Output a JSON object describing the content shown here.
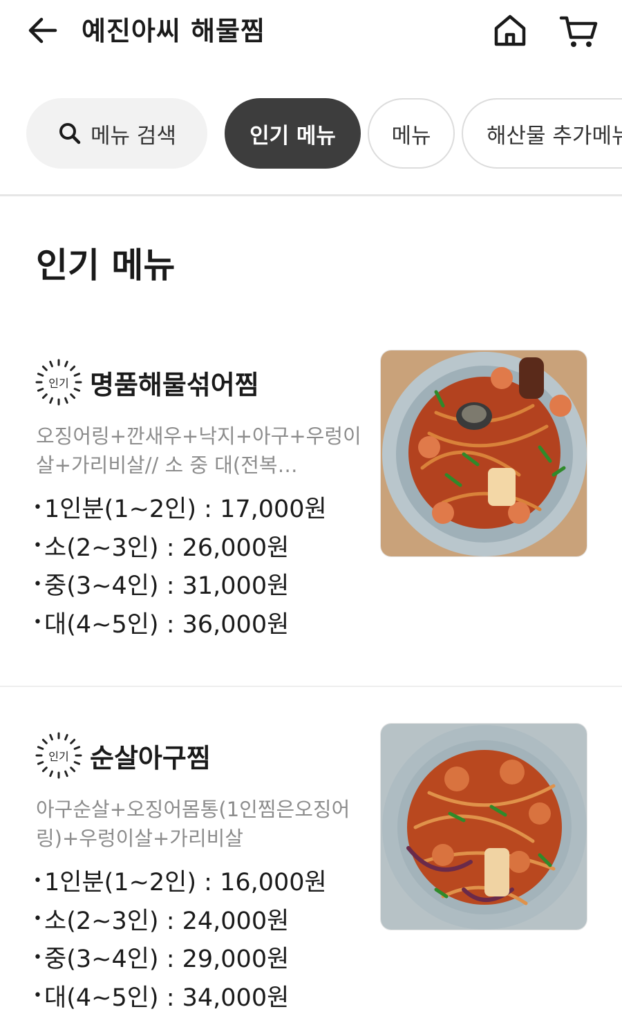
{
  "header": {
    "title": "예진아씨 해물찜",
    "back_icon": "arrow-left-icon",
    "home_icon": "home-icon",
    "cart_icon": "cart-icon"
  },
  "tabs": {
    "search_label": "메뉴 검색",
    "items": [
      {
        "label": "인기 메뉴",
        "active": true
      },
      {
        "label": "메뉴",
        "active": false
      },
      {
        "label": "해산물 추가메뉴",
        "active": false
      }
    ]
  },
  "section": {
    "title": "인기 메뉴"
  },
  "menu_items": [
    {
      "badge": "인기",
      "name": "명품해물섞어찜",
      "description": "오징어링+깐새우+낙지+아구+우렁이살+가리비살// 소 중 대(전복…",
      "prices": [
        "1인분(1~2인) : 17,000원",
        "소(2~3인) : 26,000원",
        "중(3~4인) : 31,000원",
        "대(4~5인) : 36,000원"
      ]
    },
    {
      "badge": "인기",
      "name": "순살아구찜",
      "description": "아구순살+오징어몸통(1인찜은오징어링)+우렁이살+가리비살",
      "prices": [
        "1인분(1~2인) : 16,000원",
        "소(2~3인) : 24,000원",
        "중(3~4인) : 29,000원",
        "대(4~5인) : 34,000원"
      ]
    }
  ],
  "colors": {
    "active_tab_bg": "#3d3d3d",
    "inactive_tab_border": "#dcdcdc",
    "search_bg": "#f2f2f2",
    "description_text": "#8c8c8c",
    "price_text": "#1a1a1a"
  }
}
